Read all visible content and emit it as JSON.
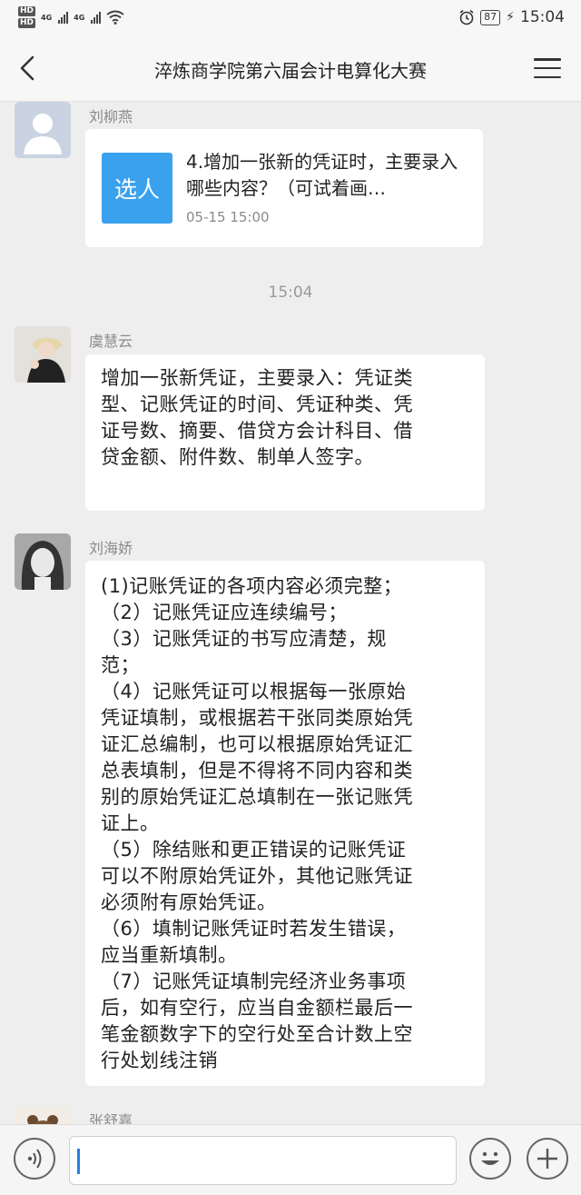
{
  "status_bar": {
    "hd1": "HD",
    "hd2": "HD",
    "net1": "4G",
    "net2": "4G",
    "battery": "87",
    "time": "15:04"
  },
  "header": {
    "title": "淬炼商学院第六届会计电算化大赛"
  },
  "messages": [
    {
      "sender": "刘柳燕",
      "card": {
        "icon_label": "选人",
        "title": "4.增加一张新的凭证时，主要录入哪些内容？（可试着画…",
        "time": "05-15 15:00"
      }
    },
    {
      "sender": "虞慧云",
      "lines": [
        "增加一张新凭证，主要录入：凭证类",
        "型、记账凭证的时间、凭证种类、凭",
        "证号数、摘要、借贷方会计科目、借",
        "贷金额、附件数、制单人签字。"
      ]
    },
    {
      "sender": "刘海娇",
      "lines": [
        "(1)记账凭证的各项内容必须完整；",
        "（2）记账凭证应连续编号；",
        "（3）记账凭证的书写应清楚，规",
        "范；",
        "（4）记账凭证可以根据每一张原始",
        "凭证填制，或根据若干张同类原始凭",
        "证汇总编制，也可以根据原始凭证汇",
        "总表填制，但是不得将不同内容和类",
        "别的原始凭证汇总填制在一张记账凭",
        "证上。",
        "（5）除结账和更正错误的记账凭证",
        "可以不附原始凭证外，其他记账凭证",
        "必须附有原始凭证。",
        "（6）填制记账凭证时若发生错误，",
        "应当重新填制。",
        "（7）记账凭证填制完经济业务事项",
        "后，如有空行，应当自金额栏最后一",
        "笔金额数字下的空行处至合计数上空",
        "行处划线注销"
      ]
    },
    {
      "sender": "张舒嘉"
    }
  ],
  "timestamp": "15:04",
  "input": {
    "value": ""
  },
  "icons": {
    "back": "chevron-left-icon",
    "menu": "hamburger-menu-icon",
    "voice": "voice-icon",
    "emoji": "emoji-icon",
    "plus": "plus-icon",
    "alarm": "alarm-icon",
    "wifi": "wifi-icon"
  }
}
